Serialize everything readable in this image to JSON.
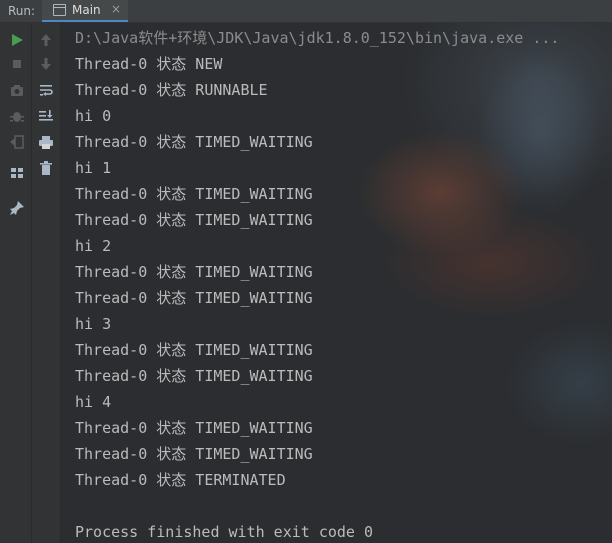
{
  "header": {
    "run_label": "Run:",
    "tab": {
      "title": "Main",
      "close": "×"
    }
  },
  "toolbar": {
    "left": [
      "run-icon",
      "stop-icon",
      "camera-icon",
      "bug-icon",
      "exit-icon",
      "layout-icon",
      "pin-icon"
    ],
    "right": [
      "up-arrow-icon",
      "down-arrow-icon",
      "soft-wrap-icon",
      "scroll-to-end-icon",
      "print-icon",
      "trash-icon"
    ]
  },
  "colors": {
    "run": "#499c54",
    "text": "#bbbbbb",
    "tab_accent": "#4a88c7"
  },
  "console": {
    "lines": [
      "D:\\Java软件+环境\\JDK\\Java\\jdk1.8.0_152\\bin\\java.exe ...",
      "Thread-0 状态 NEW",
      "Thread-0 状态 RUNNABLE",
      "hi 0",
      "Thread-0 状态 TIMED_WAITING",
      "hi 1",
      "Thread-0 状态 TIMED_WAITING",
      "Thread-0 状态 TIMED_WAITING",
      "hi 2",
      "Thread-0 状态 TIMED_WAITING",
      "Thread-0 状态 TIMED_WAITING",
      "hi 3",
      "Thread-0 状态 TIMED_WAITING",
      "Thread-0 状态 TIMED_WAITING",
      "hi 4",
      "Thread-0 状态 TIMED_WAITING",
      "Thread-0 状态 TIMED_WAITING",
      "Thread-0 状态 TERMINATED",
      "",
      "Process finished with exit code 0"
    ]
  }
}
